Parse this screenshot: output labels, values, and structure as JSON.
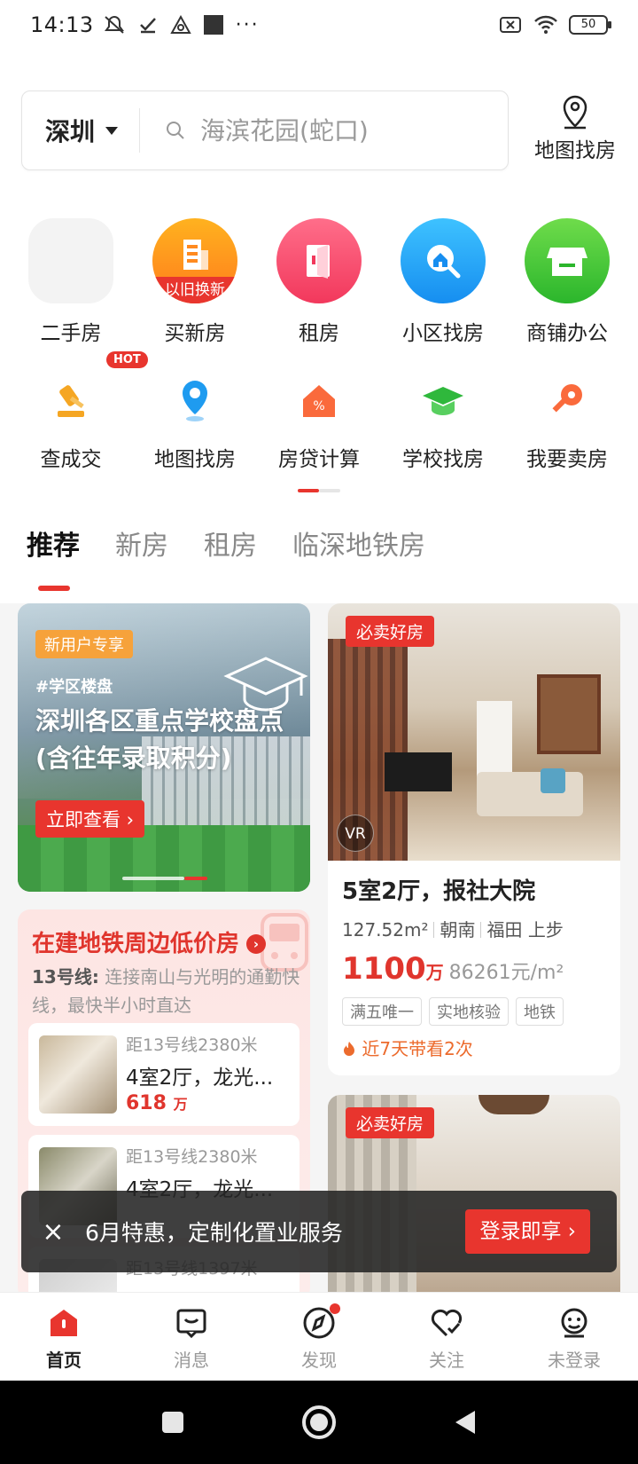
{
  "status_bar": {
    "time": "14:13",
    "battery": "50"
  },
  "search": {
    "city": "深圳",
    "placeholder": "海滨花园(蛇口)"
  },
  "map_button": {
    "label": "地图找房"
  },
  "tiles": [
    {
      "label": "二手房",
      "icon": "house-placeholder-icon"
    },
    {
      "label": "买新房",
      "badge": "以旧换新",
      "icon": "building-icon"
    },
    {
      "label": "租房",
      "icon": "door-icon"
    },
    {
      "label": "小区找房",
      "icon": "search-house-icon"
    },
    {
      "label": "商铺办公",
      "icon": "shop-icon"
    }
  ],
  "tools": [
    {
      "label": "查成交",
      "badge": "HOT",
      "icon": "gavel-icon"
    },
    {
      "label": "地图找房",
      "icon": "map-pin-icon"
    },
    {
      "label": "房贷计算",
      "icon": "percent-house-icon"
    },
    {
      "label": "学校找房",
      "icon": "graduation-cap-icon"
    },
    {
      "label": "我要卖房",
      "icon": "key-icon"
    }
  ],
  "category_tabs": [
    "推荐",
    "新房",
    "租房",
    "临深地铁房"
  ],
  "promo": {
    "tag": "新用户专享",
    "hashtag": "#学区楼盘",
    "title": "深圳各区重点学校盘点(含往年录取积分)",
    "cta": "立即查看"
  },
  "metro": {
    "title": "在建地铁周边低价房",
    "line": "13号线:",
    "desc": "连接南山与光明的通勤快线，最快半小时直达",
    "items": [
      {
        "distance": "距13号线2380米",
        "name": "4室2厅，龙光...",
        "price": "618",
        "unit": "万"
      },
      {
        "distance": "距13号线2380米",
        "name": "4室2厅，龙光...",
        "price": "",
        "unit": ""
      },
      {
        "distance": "距13号线1397米",
        "name": "",
        "price": "",
        "unit": ""
      }
    ]
  },
  "listing": {
    "tag": "必卖好房",
    "vr": "VR",
    "title": "5室2厅，报社大院",
    "area": "127.52m²",
    "orientation": "朝南",
    "district": "福田 上步",
    "price": "1100",
    "price_unit": "万",
    "unit_price": "86261元/m²",
    "tags": [
      "满五唯一",
      "实地核验",
      "地铁"
    ],
    "views": "近7天带看2次"
  },
  "listing2": {
    "tag": "必卖好房"
  },
  "toast": {
    "message": "6月特惠，定制化置业服务",
    "button": "登录即享"
  },
  "bottom_nav": [
    "首页",
    "消息",
    "发现",
    "关注",
    "未登录"
  ],
  "colors": {
    "brand_red": "#e8352e",
    "orange": "#ec6b2d"
  }
}
